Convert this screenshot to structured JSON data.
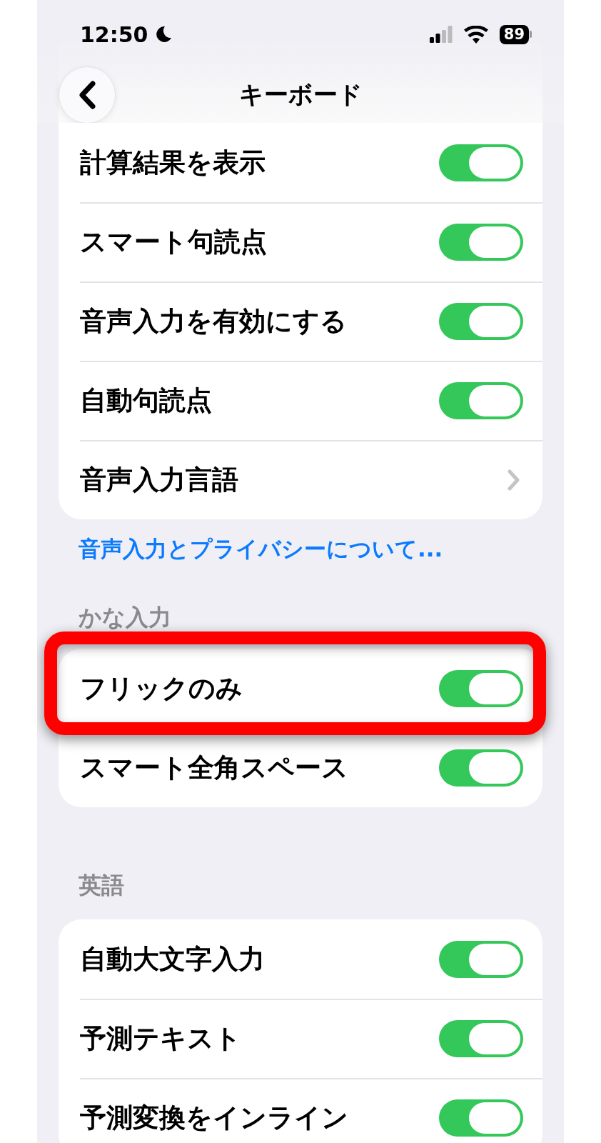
{
  "status_bar": {
    "time": "12:50",
    "battery": "89"
  },
  "nav": {
    "title": "キーボード"
  },
  "groups": [
    {
      "rows": [
        {
          "kind": "toggle",
          "label": "計算結果を表示",
          "on": true,
          "highlighted": false
        },
        {
          "kind": "toggle",
          "label": "スマート句読点",
          "on": true,
          "highlighted": false
        },
        {
          "kind": "toggle",
          "label": "音声入力を有効にする",
          "on": true,
          "highlighted": false
        },
        {
          "kind": "toggle",
          "label": "自動句読点",
          "on": true,
          "highlighted": false
        },
        {
          "kind": "link",
          "label": "音声入力言語",
          "highlighted": false
        }
      ],
      "footer_link": "音声入力とプライバシーについて..."
    },
    {
      "header": "かな入力",
      "rows": [
        {
          "kind": "toggle",
          "label": "フリックのみ",
          "on": true,
          "highlighted": true
        },
        {
          "kind": "toggle",
          "label": "スマート全角スペース",
          "on": true,
          "highlighted": false
        }
      ]
    },
    {
      "header": "英語",
      "rows": [
        {
          "kind": "toggle",
          "label": "自動大文字入力",
          "on": true,
          "highlighted": false
        },
        {
          "kind": "toggle",
          "label": "予測テキスト",
          "on": true,
          "highlighted": false
        },
        {
          "kind": "toggle",
          "label": "予測変換をインライン",
          "on": true,
          "highlighted": false
        }
      ]
    }
  ]
}
